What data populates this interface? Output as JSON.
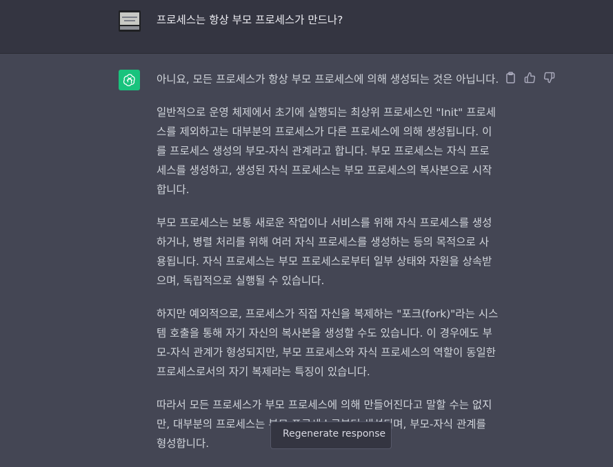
{
  "user_message": {
    "text": "프로세스는 항상 부모 프로세스가 만드나?"
  },
  "assistant_message": {
    "paragraphs": [
      "아니요, 모든 프로세스가 항상 부모 프로세스에 의해 생성되는 것은 아닙니다.",
      "일반적으로 운영 체제에서 초기에 실행되는 최상위 프로세스인 \"Init\" 프로세스를 제외하고는 대부분의 프로세스가 다른 프로세스에 의해 생성됩니다. 이를 프로세스 생성의 부모-자식 관계라고 합니다. 부모 프로세스는 자식 프로세스를 생성하고, 생성된 자식 프로세스는 부모 프로세스의 복사본으로 시작합니다.",
      "부모 프로세스는 보통 새로운 작업이나 서비스를 위해 자식 프로세스를 생성하거나, 병렬 처리를 위해 여러 자식 프로세스를 생성하는 등의 목적으로 사용됩니다. 자식 프로세스는 부모 프로세스로부터 일부 상태와 자원을 상속받으며, 독립적으로 실행될 수 있습니다.",
      "하지만 예외적으로, 프로세스가 직접 자신을 복제하는 \"포크(fork)\"라는 시스템 호출을 통해 자기 자신의 복사본을 생성할 수도 있습니다. 이 경우에도 부모-자식 관계가 형성되지만, 부모 프로세스와 자식 프로세스의 역할이 동일한 프로세스로서의 자기 복제라는 특징이 있습니다.",
      "따라서 모든 프로세스가 부모 프로세스에 의해 만들어진다고 말할 수는 없지만, 대부분의 프로세스는 부모 프로세스로부터 생성되며, 부모-자식 관계를 형성합니다."
    ]
  },
  "actions": {
    "icons": [
      "clipboard-icon",
      "thumbs-up-icon",
      "thumbs-down-icon"
    ]
  },
  "regenerate": {
    "label": "Regenerate response"
  },
  "colors": {
    "user_bg": "#343541",
    "assistant_bg": "#444654",
    "bot_avatar": "#19c37d",
    "text": "#d1d5db"
  }
}
